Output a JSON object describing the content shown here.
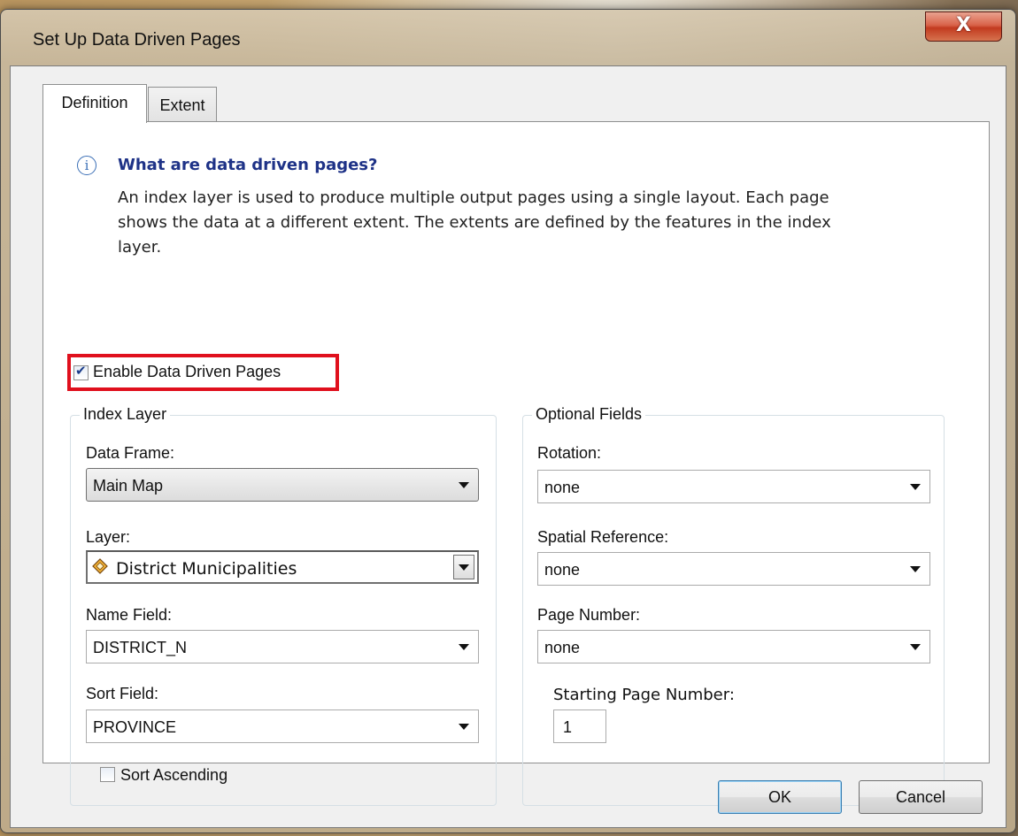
{
  "window": {
    "title": "Set Up Data Driven Pages",
    "close_glyph": "X"
  },
  "tabs": [
    {
      "label": "Definition",
      "active": true
    },
    {
      "label": "Extent",
      "active": false
    }
  ],
  "info": {
    "icon": "info-icon",
    "icon_glyph": "i",
    "heading": "What are data driven pages?",
    "lines": [
      "An index layer is used to produce multiple output pages using a single layout.  Each page",
      "shows the data at a different extent.  The extents are defined by the features in the index",
      "layer."
    ]
  },
  "enable": {
    "label": "Enable Data Driven Pages",
    "checked": true,
    "highlight_color": "#e0101d"
  },
  "index_layer": {
    "group_label": "Index Layer",
    "data_frame": {
      "label": "Data Frame:",
      "value": "Main Map"
    },
    "layer": {
      "label": "Layer:",
      "value": "District Municipalities",
      "icon": "polygon-layer-icon"
    },
    "name_field": {
      "label": "Name Field:",
      "value": "DISTRICT_N"
    },
    "sort_field": {
      "label": "Sort Field:",
      "value": "PROVINCE"
    },
    "sort_ascending": {
      "label": "Sort Ascending",
      "checked": false
    }
  },
  "optional_fields": {
    "group_label": "Optional Fields",
    "rotation": {
      "label": "Rotation:",
      "value": "none"
    },
    "spatial_reference": {
      "label": "Spatial Reference:",
      "value": "none"
    },
    "page_number": {
      "label": "Page Number:",
      "value": "none"
    },
    "starting_page_number": {
      "label": "Starting Page Number:",
      "value": "1"
    }
  },
  "buttons": {
    "ok": "OK",
    "cancel": "Cancel"
  }
}
